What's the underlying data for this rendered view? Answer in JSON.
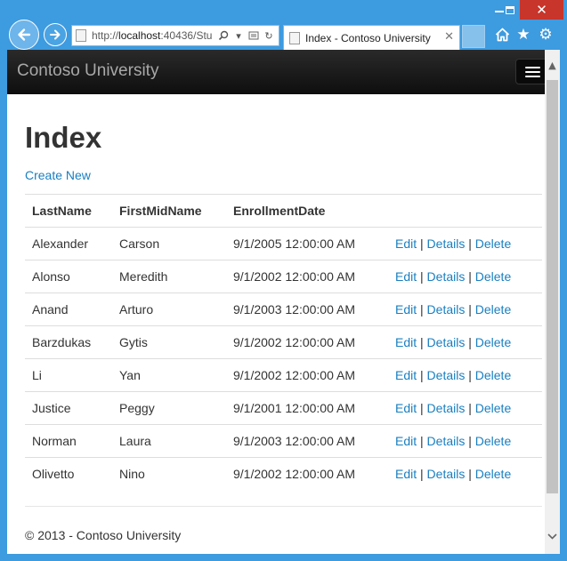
{
  "browser": {
    "address": {
      "scheme": "http://",
      "host": "localhost",
      "rest": ":40436/Stu"
    },
    "tab": {
      "title": "Index - Contoso University"
    },
    "icons": [
      "back-icon",
      "forward-icon",
      "search-icon",
      "dropdown-icon",
      "compat-icon",
      "refresh-icon",
      "close-tab-icon",
      "home-icon",
      "favorites-icon",
      "settings-icon"
    ],
    "accent": "#2b8fd6",
    "close_color": "#c7352b"
  },
  "navbar": {
    "brand": "Contoso University"
  },
  "page": {
    "title": "Index",
    "create_new": "Create New",
    "columns": [
      "LastName",
      "FirstMidName",
      "EnrollmentDate"
    ],
    "rows": [
      {
        "last": "Alexander",
        "first": "Carson",
        "date": "9/1/2005 12:00:00 AM"
      },
      {
        "last": "Alonso",
        "first": "Meredith",
        "date": "9/1/2002 12:00:00 AM"
      },
      {
        "last": "Anand",
        "first": "Arturo",
        "date": "9/1/2003 12:00:00 AM"
      },
      {
        "last": "Barzdukas",
        "first": "Gytis",
        "date": "9/1/2002 12:00:00 AM"
      },
      {
        "last": "Li",
        "first": "Yan",
        "date": "9/1/2002 12:00:00 AM"
      },
      {
        "last": "Justice",
        "first": "Peggy",
        "date": "9/1/2001 12:00:00 AM"
      },
      {
        "last": "Norman",
        "first": "Laura",
        "date": "9/1/2003 12:00:00 AM"
      },
      {
        "last": "Olivetto",
        "first": "Nino",
        "date": "9/1/2002 12:00:00 AM"
      }
    ],
    "actions": {
      "edit": "Edit",
      "details": "Details",
      "delete": "Delete",
      "separator": "|"
    },
    "link_color": "#1a7fc0"
  },
  "footer": {
    "text": "© 2013 - Contoso University"
  }
}
